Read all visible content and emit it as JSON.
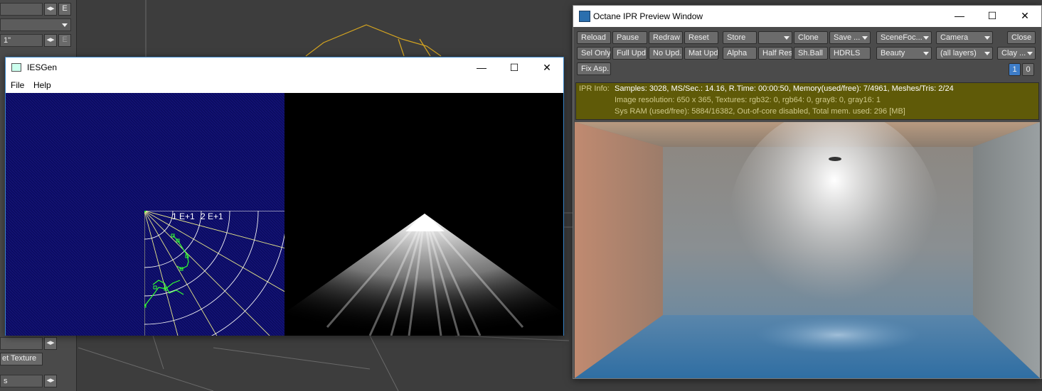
{
  "lightwave": {
    "e_label": "E",
    "field_value": "1\"",
    "texture_button": "et Texture",
    "field_bottom": "s"
  },
  "iesgen": {
    "title": "IESGen",
    "menu": [
      "File",
      "Help"
    ],
    "polar_labels": [
      "1 E+1",
      "2 E+1"
    ],
    "window_controls": [
      "—",
      "☐",
      "✕"
    ]
  },
  "octane": {
    "title": "Octane IPR Preview Window",
    "window_controls": [
      "—",
      "☐",
      "✕"
    ],
    "row1": [
      "Reload",
      "Pause",
      "Redraw",
      "Reset",
      "Store",
      "",
      "Clone",
      "Save ...",
      "SceneFoc...",
      "Camera",
      "Close"
    ],
    "row2": [
      "Sel Only",
      "Full Upd.",
      "No Upd.",
      "Mat Upd",
      "Alpha",
      "Half Res",
      "Sh.Ball",
      "HDRLS",
      "Beauty",
      "(all layers)",
      "Clay ..."
    ],
    "row3": [
      "Fix Asp."
    ],
    "counter": [
      "1",
      "0"
    ],
    "info_label": "IPR Info:",
    "info_lines": [
      "Samples: 3028, MS/Sec.: 14.16, R.Time: 00:00:50, Memory(used/free): 7/4961, Meshes/Tris: 2/24",
      "Image resolution: 650 x 365, Textures:  rgb32: 0, rgb64: 0, gray8: 0, gray16: 1",
      "Sys RAM (used/free): 5884/16382, Out-of-core disabled, Total mem. used: 296  [MB]"
    ]
  }
}
